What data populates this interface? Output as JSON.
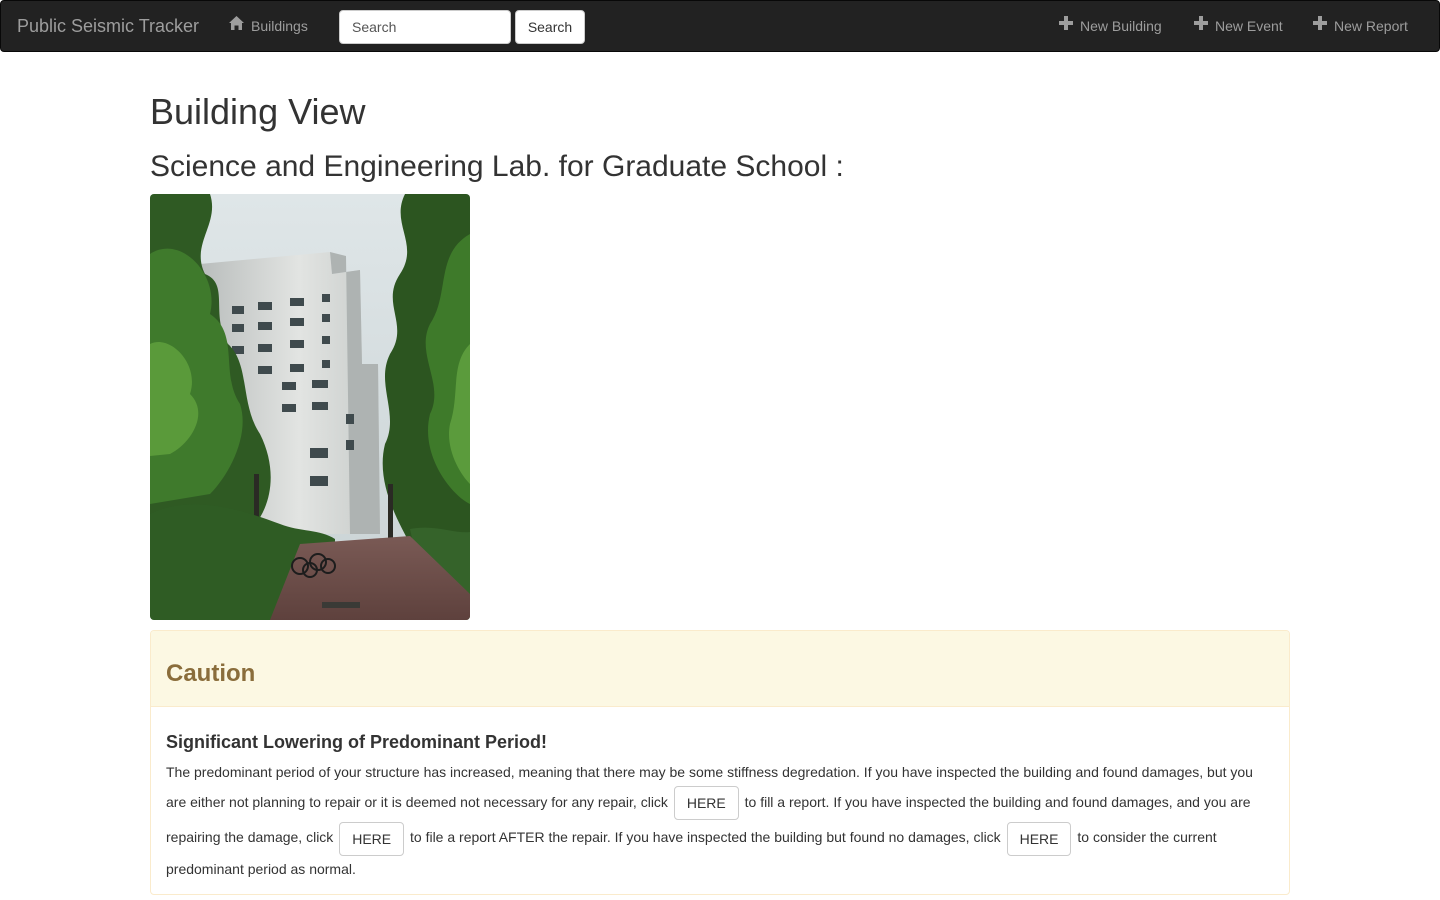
{
  "navbar": {
    "brand": "Public Seismic Tracker",
    "buildings_label": "Buildings",
    "search_placeholder": "Search",
    "search_button": "Search",
    "new_building": "New Building",
    "new_event": "New Event",
    "new_report": "New Report",
    "icons": {
      "buildings": "home-icon",
      "new": "plus-icon"
    }
  },
  "main": {
    "page_title": "Building View",
    "building_name": "Science and Engineering Lab. for Graduate School :"
  },
  "caution": {
    "title": "Caution",
    "subtitle": "Significant Lowering of Predominant Period!",
    "line1": "The predominant period of your structure has increased, meaning that there may be some stiffness degredation. If you have inspected the building and found damages, but you",
    "line2a": "are either not planning to repair or it is deemed not necessary for any repair, click",
    "line2b": "to fill a report. If you have inspected the building and found damages, and you are",
    "line3a": "repairing the damage, click",
    "line3b": "to file a report AFTER the repair. If you have inspected the building but found no damages, click",
    "line3c": "to consider the current",
    "line4": "predominant period as normal.",
    "here_label": "HERE"
  },
  "colors": {
    "navbar_bg": "#222222",
    "navbar_text": "#9d9d9d",
    "warning_bg": "#fcf8e3",
    "warning_text": "#8a6d3b",
    "warning_border": "#faebcc"
  }
}
